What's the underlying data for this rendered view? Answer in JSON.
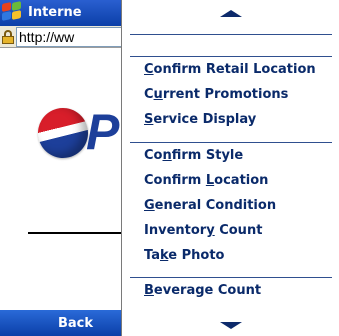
{
  "window": {
    "title": "Interne"
  },
  "address_bar": {
    "url": "http://ww"
  },
  "page": {
    "logo_text": "P"
  },
  "softkeys": {
    "left": "Back"
  },
  "menu": {
    "groups": [
      [
        {
          "label": "Confirm Retail Location",
          "accel_index": 0
        },
        {
          "label": "Current Promotions",
          "accel_index": 1
        },
        {
          "label": "Service Display",
          "accel_index": 0
        }
      ],
      [
        {
          "label": "Confirm Style",
          "accel_index": 2
        },
        {
          "label": "Confirm Location",
          "accel_index": 8
        },
        {
          "label": "General Condition",
          "accel_index": 0
        },
        {
          "label": "Inventory Count",
          "accel_index": 8
        },
        {
          "label": "Take Photo",
          "accel_index": 2
        }
      ],
      [
        {
          "label": "Beverage Count",
          "accel_index": 0
        }
      ]
    ]
  },
  "colors": {
    "menu_text": "#0a2a6a",
    "title_bar": "#0b3fa8",
    "pepsi_blue": "#1d3f9a",
    "pepsi_red": "#d81e2a"
  }
}
